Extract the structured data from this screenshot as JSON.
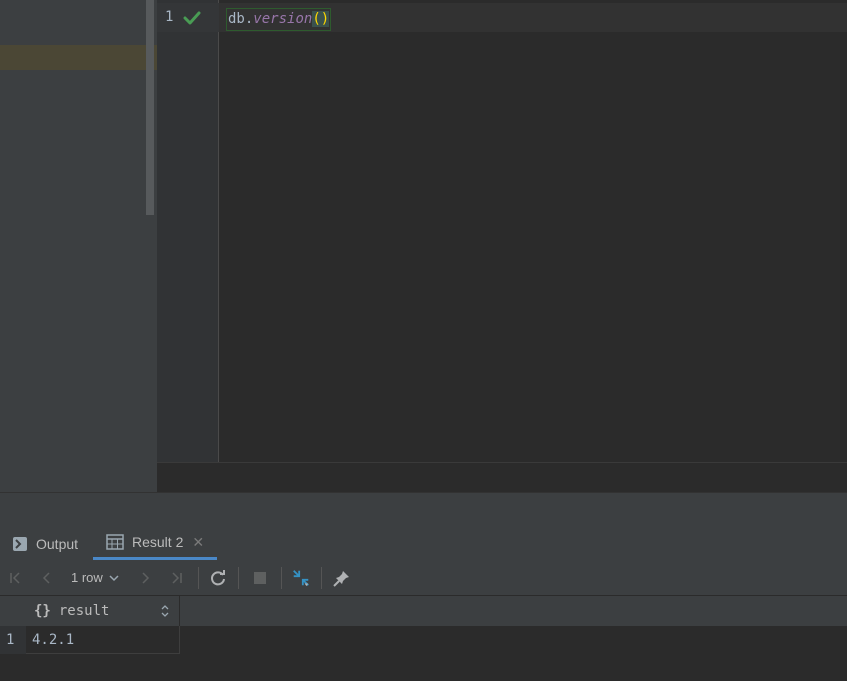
{
  "editor": {
    "line_number": "1",
    "status_icon": "check-icon",
    "code": {
      "obj": "db",
      "dot": ".",
      "method": "version",
      "parens": "()"
    }
  },
  "tabs": [
    {
      "label": "Output",
      "icon": "console-icon",
      "active": false
    },
    {
      "label": "Result 2",
      "icon": "table-icon",
      "active": true,
      "closable": true
    }
  ],
  "toolbar": {
    "row_count": "1 row",
    "buttons": [
      "first-page-icon",
      "prev-page-icon",
      "next-page-icon",
      "last-page-icon",
      "refresh-icon",
      "stop-icon",
      "compare-icon",
      "pin-icon"
    ]
  },
  "grid": {
    "columns": [
      {
        "name": "result",
        "type_icon": "{}"
      }
    ],
    "rows": [
      {
        "num": "1",
        "cells": [
          "4.2.1"
        ]
      }
    ]
  },
  "colors": {
    "accent": "#4a88c7",
    "check": "#499c54",
    "method": "#9876aa",
    "paren": "#ffd700"
  }
}
